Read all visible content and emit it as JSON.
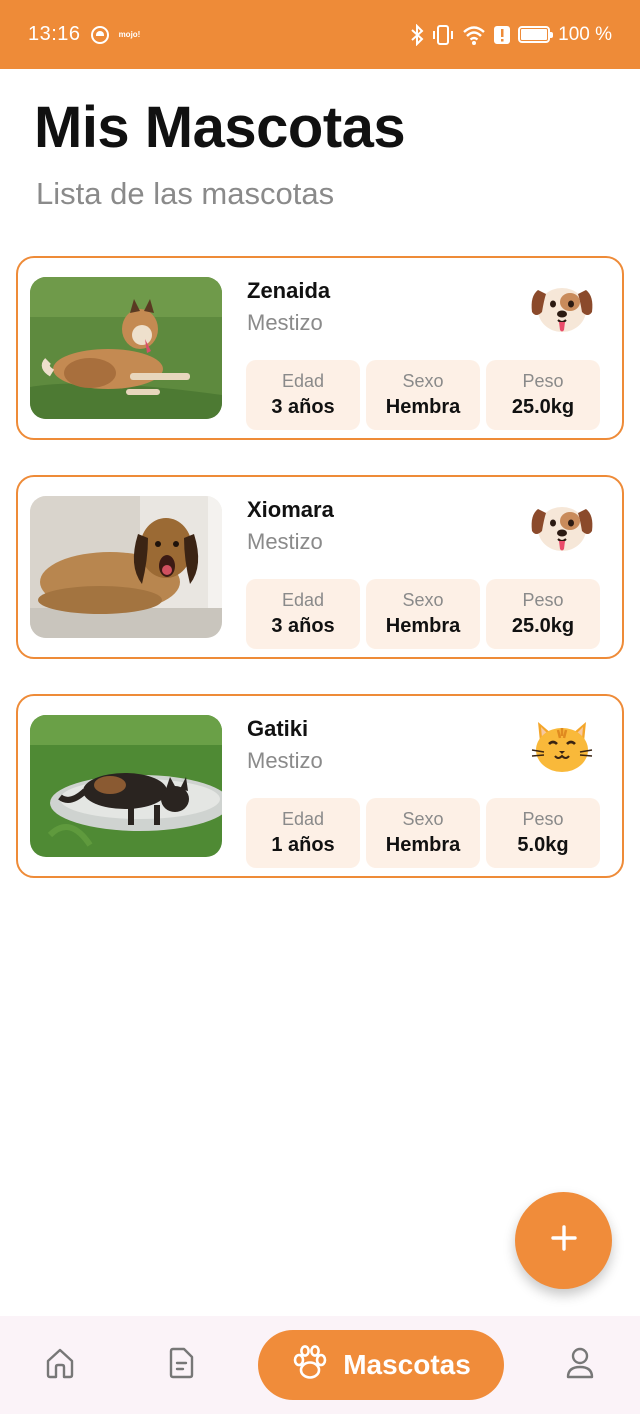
{
  "status_bar": {
    "time": "13:16",
    "small_text": "mojo!",
    "battery_text": "100 %"
  },
  "header": {
    "title": "Mis Mascotas",
    "subtitle": "Lista de las mascotas"
  },
  "labels": {
    "age": "Edad",
    "sex": "Sexo",
    "weight": "Peso"
  },
  "pets": [
    {
      "name": "Zenaida",
      "breed": "Mestizo",
      "age": "3 años",
      "sex": "Hembra",
      "weight": "25.0kg",
      "emoji_icon": "dog-face-icon"
    },
    {
      "name": "Xiomara",
      "breed": "Mestizo",
      "age": "3 años",
      "sex": "Hembra",
      "weight": "25.0kg",
      "emoji_icon": "dog-face-icon"
    },
    {
      "name": "Gatiki",
      "breed": "Mestizo",
      "age": "1 años",
      "sex": "Hembra",
      "weight": "5.0kg",
      "emoji_icon": "cat-face-icon"
    }
  ],
  "bottom_nav": {
    "active_label": "Mascotas",
    "items": [
      "home-icon",
      "document-icon",
      "paw-icon",
      "profile-icon"
    ]
  },
  "colors": {
    "accent": "#EE8B38",
    "stat_bg": "#FDF0E6",
    "nav_bg": "#FBF3F8"
  }
}
